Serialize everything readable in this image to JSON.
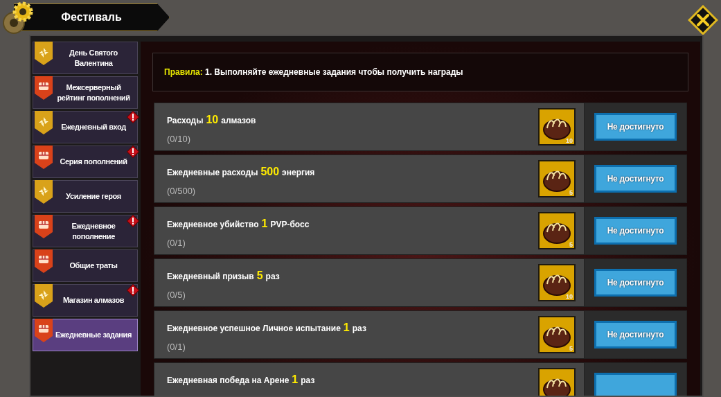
{
  "window": {
    "title": "Фестиваль"
  },
  "sidebar": {
    "items": [
      {
        "label": "День Святого Валентина",
        "kind": "pinwheel",
        "alert": false,
        "selected": false
      },
      {
        "label": "Межсерверный рейтинг пополнений",
        "kind": "chest",
        "alert": false,
        "selected": false
      },
      {
        "label": "Ежедневный вход",
        "kind": "pinwheel",
        "alert": true,
        "selected": false
      },
      {
        "label": "Серия пополнений",
        "kind": "chest",
        "alert": true,
        "selected": false
      },
      {
        "label": "Усиление героя",
        "kind": "pinwheel",
        "alert": false,
        "selected": false
      },
      {
        "label": "Ежедневное пополнение",
        "kind": "chest",
        "alert": true,
        "selected": false
      },
      {
        "label": "Общие траты",
        "kind": "chest",
        "alert": false,
        "selected": false
      },
      {
        "label": "Магазин алмазов",
        "kind": "pinwheel",
        "alert": true,
        "selected": false
      },
      {
        "label": "Ежедневные задания",
        "kind": "chest",
        "alert": false,
        "selected": true
      }
    ]
  },
  "rules": {
    "label": "Правила:",
    "text": "1. Выполняйте ежедневные задания чтобы получить награды"
  },
  "tasks": [
    {
      "text_before": "Расходы",
      "amount": "10",
      "text_after": "алмазов",
      "progress": "(0/10)",
      "reward_count": "10",
      "button": "Не достигнуто"
    },
    {
      "text_before": "Ежедневные расходы",
      "amount": "500",
      "text_after": "энергия",
      "progress": "(0/500)",
      "reward_count": "5",
      "button": "Не достигнуто"
    },
    {
      "text_before": "Ежедневное убийство",
      "amount": "1",
      "text_after": "PVP-босс",
      "progress": "(0/1)",
      "reward_count": "5",
      "button": "Не достигнуто"
    },
    {
      "text_before": "Ежедневный призыв",
      "amount": "5",
      "text_after": "раз",
      "progress": "(0/5)",
      "reward_count": "10",
      "button": "Не достигнуто"
    },
    {
      "text_before": "Ежедневное успешное Личное испытание",
      "amount": "1",
      "text_after": "раз",
      "progress": "(0/1)",
      "reward_count": "5",
      "button": "Не достигнуто"
    },
    {
      "text_before": "Ежедневная победа на Арене",
      "amount": "1",
      "text_after": "раз"
    }
  ]
}
